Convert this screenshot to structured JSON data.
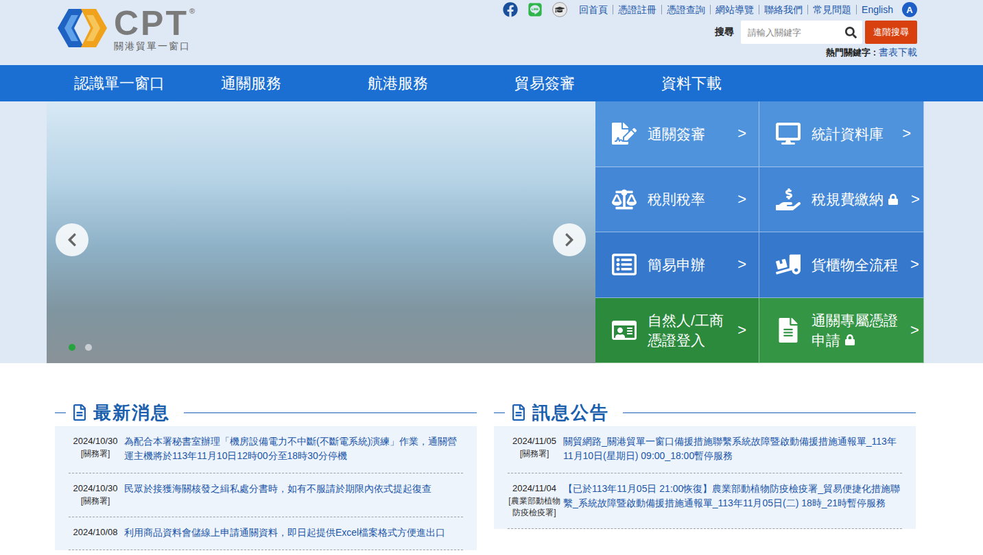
{
  "logo": {
    "mark": "CPT",
    "reg": "®",
    "subtitle": "關港貿單一窗口"
  },
  "top_links": [
    "回首頁",
    "憑證註冊",
    "憑證查詢",
    "網站導覽",
    "聯絡我們",
    "常見問題",
    "English"
  ],
  "a11y_button": "A",
  "search": {
    "label": "搜尋",
    "placeholder": "請輸入關鍵字",
    "advanced_button": "進階搜尋"
  },
  "hot_keywords": {
    "label": "熱門關鍵字 :",
    "items": [
      "書表下載"
    ]
  },
  "nav": [
    "認識單一窗口",
    "通關服務",
    "航港服務",
    "貿易簽審",
    "資料下載"
  ],
  "carousel": {
    "dots": [
      {
        "selected": true
      },
      {
        "selected": false
      }
    ]
  },
  "tiles": [
    {
      "lines": [
        "通關簽審"
      ],
      "arrow": ">",
      "locked": false,
      "color": "#4f93dd"
    },
    {
      "lines": [
        "統計資料庫"
      ],
      "arrow": ">",
      "locked": false,
      "color": "#4f93dd"
    },
    {
      "lines": [
        "稅則稅率"
      ],
      "arrow": ">",
      "locked": false,
      "color": "#4387d6"
    },
    {
      "lines": [
        "稅規費繳納"
      ],
      "arrow": ">",
      "locked": true,
      "color": "#4387d6"
    },
    {
      "lines": [
        "簡易申辦"
      ],
      "arrow": ">",
      "locked": false,
      "color": "#3679cc"
    },
    {
      "lines": [
        "貨櫃物全流程"
      ],
      "arrow": ">",
      "locked": false,
      "color": "#3679cc"
    },
    {
      "lines": [
        "自然人/工商",
        "憑證登入"
      ],
      "arrow": ">",
      "locked": false,
      "color": "#2b8a3c"
    },
    {
      "lines": [
        "通關專屬憑證",
        "申請"
      ],
      "arrow": ">",
      "locked": true,
      "color": "#349645"
    }
  ],
  "news": {
    "title": "最新消息",
    "items": [
      {
        "date": "2024/10/30",
        "source": "[關務署]",
        "text": "為配合本署秘書室辦理「機房設備電力不中斷(不斷電系統)演練」作業，通關營運主機將於113年11月10日12時00分至18時30分停機"
      },
      {
        "date": "2024/10/30",
        "source": "[關務署]",
        "text": "民眾於接獲海關核發之緝私處分書時，如有不服請於期限內依式提起復查"
      },
      {
        "date": "2024/10/08",
        "source": "",
        "text": "利用商品資料會儲線上申請通關資料，即日起提供Excel檔案格式方便進出口"
      }
    ]
  },
  "announcements": {
    "title": "訊息公告",
    "items": [
      {
        "date": "2024/11/05",
        "source": "[關務署]",
        "text": "關貿網路_關港貿單一窗口備援措施聯繫系統故障暨啟動備援措施通報單_113年11月10日(星期日) 09:00_18:00暫停服務"
      },
      {
        "date": "2024/11/04",
        "source": "[農業部動植物防疫檢疫署]",
        "text": "【已於113年11月05日 21:00恢復】農業部動植物防疫檢疫署_貿易便捷化措施聯繫_系統故障暨啟動備援措施通報單_113年11月05日(二) 18時_21時暫停服務"
      }
    ]
  }
}
